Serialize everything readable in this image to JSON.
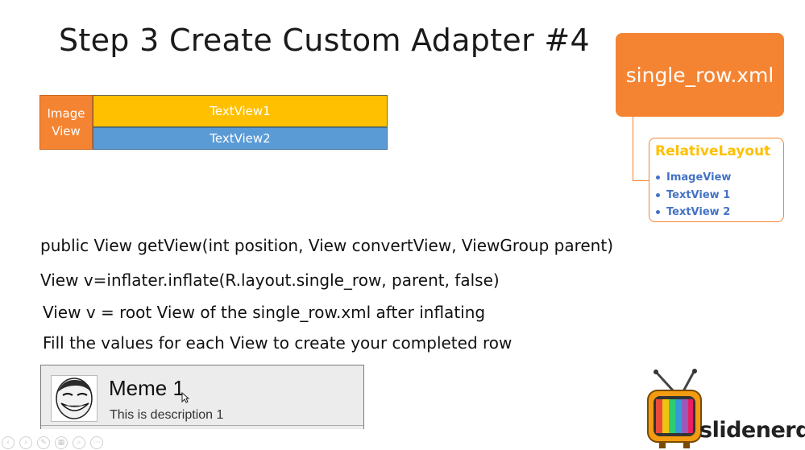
{
  "slide": {
    "title": "Step 3 Create Custom Adapter #4"
  },
  "diagram": {
    "image_view_line1": "Image",
    "image_view_line2": "View",
    "textview1": "TextView1",
    "textview2": "TextView2",
    "colors": {
      "image_view": "#f58432",
      "textview1": "#ffc000",
      "textview2": "#5b9bd5"
    }
  },
  "xml_tree": {
    "file": "single_row.xml",
    "root": "RelativeLayout",
    "children": [
      "ImageView",
      "TextView 1",
      "TextView 2"
    ],
    "colors": {
      "box": "#f58432",
      "root_label": "#ffc000",
      "children": "#4472c4"
    }
  },
  "code": {
    "line1": "public View getView(int position, View convertView, ViewGroup parent)",
    "line2": "View v=inflater.inflate(R.layout.single_row, parent, false)",
    "line3": "View v = root View of the single_row.xml after inflating",
    "line4": "Fill the values for each View to create your completed row"
  },
  "preview": {
    "title": "Meme 1",
    "description": "This is description 1",
    "avatar_icon": "troll-face-icon"
  },
  "logo": {
    "text": "slidenerd",
    "icon": "retro-tv-icon"
  },
  "controls": {
    "icons": [
      "prev-icon",
      "next-icon",
      "pen-icon",
      "slides-icon",
      "zoom-icon",
      "more-icon"
    ],
    "glyphs": [
      "‹",
      "›",
      "✎",
      "▦",
      "⌕",
      "⋯"
    ]
  }
}
